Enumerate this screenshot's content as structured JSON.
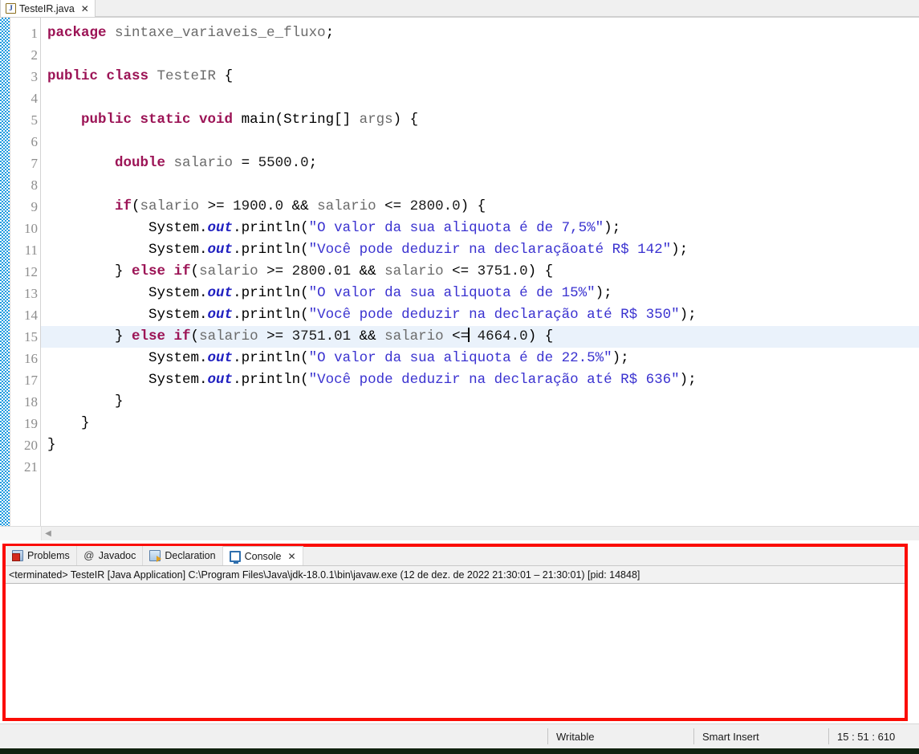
{
  "editor": {
    "tab": {
      "title": "TesteIR.java",
      "icon": "java-file-icon",
      "letter": "J",
      "close": "✕"
    },
    "gutter_lines": [
      "1",
      "2",
      "3",
      "4",
      "5",
      "6",
      "7",
      "8",
      "9",
      "10",
      "11",
      "12",
      "13",
      "14",
      "15",
      "16",
      "17",
      "18",
      "19",
      "20",
      "21"
    ],
    "fold_line": "5",
    "current_line": 15,
    "caret_line_index": 14,
    "code_lines": [
      [
        {
          "t": "package",
          "c": "kw"
        },
        {
          "t": " ",
          "c": "pl"
        },
        {
          "t": "sintaxe_variaveis_e_fluxo",
          "c": "id"
        },
        {
          "t": ";",
          "c": "pl"
        }
      ],
      [],
      [
        {
          "t": "public class",
          "c": "kw"
        },
        {
          "t": " ",
          "c": "pl"
        },
        {
          "t": "TesteIR",
          "c": "id"
        },
        {
          "t": " {",
          "c": "pl"
        }
      ],
      [],
      [
        {
          "t": "    ",
          "c": "pl"
        },
        {
          "t": "public static void",
          "c": "kw"
        },
        {
          "t": " ",
          "c": "pl"
        },
        {
          "t": "main",
          "c": "pl"
        },
        {
          "t": "(",
          "c": "pl"
        },
        {
          "t": "String",
          "c": "pl"
        },
        {
          "t": "[] ",
          "c": "pl"
        },
        {
          "t": "args",
          "c": "id"
        },
        {
          "t": ") {",
          "c": "pl"
        }
      ],
      [],
      [
        {
          "t": "        ",
          "c": "pl"
        },
        {
          "t": "double",
          "c": "kw"
        },
        {
          "t": " ",
          "c": "pl"
        },
        {
          "t": "salario",
          "c": "id"
        },
        {
          "t": " = ",
          "c": "pl"
        },
        {
          "t": "5500.0",
          "c": "num"
        },
        {
          "t": ";",
          "c": "pl"
        }
      ],
      [],
      [
        {
          "t": "        ",
          "c": "pl"
        },
        {
          "t": "if",
          "c": "kw"
        },
        {
          "t": "(",
          "c": "pl"
        },
        {
          "t": "salario",
          "c": "id"
        },
        {
          "t": " >= ",
          "c": "pl"
        },
        {
          "t": "1900.0",
          "c": "num"
        },
        {
          "t": " && ",
          "c": "pl"
        },
        {
          "t": "salario",
          "c": "id"
        },
        {
          "t": " <= ",
          "c": "pl"
        },
        {
          "t": "2800.0",
          "c": "num"
        },
        {
          "t": ") {",
          "c": "pl"
        }
      ],
      [
        {
          "t": "            System.",
          "c": "pl"
        },
        {
          "t": "out",
          "c": "fld"
        },
        {
          "t": ".println(",
          "c": "pl"
        },
        {
          "t": "\"O valor da sua aliquota é de 7,5%\"",
          "c": "str"
        },
        {
          "t": ");",
          "c": "pl"
        }
      ],
      [
        {
          "t": "            System.",
          "c": "pl"
        },
        {
          "t": "out",
          "c": "fld"
        },
        {
          "t": ".println(",
          "c": "pl"
        },
        {
          "t": "\"Você pode deduzir na declaraçãoaté R$ 142\"",
          "c": "str"
        },
        {
          "t": ");",
          "c": "pl"
        }
      ],
      [
        {
          "t": "        } ",
          "c": "pl"
        },
        {
          "t": "else if",
          "c": "kw"
        },
        {
          "t": "(",
          "c": "pl"
        },
        {
          "t": "salario",
          "c": "id"
        },
        {
          "t": " >= ",
          "c": "pl"
        },
        {
          "t": "2800.01",
          "c": "num"
        },
        {
          "t": " && ",
          "c": "pl"
        },
        {
          "t": "salario",
          "c": "id"
        },
        {
          "t": " <= ",
          "c": "pl"
        },
        {
          "t": "3751.0",
          "c": "num"
        },
        {
          "t": ") {",
          "c": "pl"
        }
      ],
      [
        {
          "t": "            System.",
          "c": "pl"
        },
        {
          "t": "out",
          "c": "fld"
        },
        {
          "t": ".println(",
          "c": "pl"
        },
        {
          "t": "\"O valor da sua aliquota é de 15%\"",
          "c": "str"
        },
        {
          "t": ");",
          "c": "pl"
        }
      ],
      [
        {
          "t": "            System.",
          "c": "pl"
        },
        {
          "t": "out",
          "c": "fld"
        },
        {
          "t": ".println(",
          "c": "pl"
        },
        {
          "t": "\"Você pode deduzir na declaração até R$ 350\"",
          "c": "str"
        },
        {
          "t": ");",
          "c": "pl"
        }
      ],
      [
        {
          "t": "        } ",
          "c": "pl"
        },
        {
          "t": "else if",
          "c": "kw"
        },
        {
          "t": "(",
          "c": "pl"
        },
        {
          "t": "salario",
          "c": "id"
        },
        {
          "t": " >= ",
          "c": "pl"
        },
        {
          "t": "3751.01",
          "c": "num"
        },
        {
          "t": " && ",
          "c": "pl"
        },
        {
          "t": "salario",
          "c": "id"
        },
        {
          "t": " <=",
          "c": "pl"
        },
        {
          "t": "CARET",
          "c": "caret"
        },
        {
          "t": " ",
          "c": "pl"
        },
        {
          "t": "4664.0",
          "c": "num"
        },
        {
          "t": ") {",
          "c": "pl"
        }
      ],
      [
        {
          "t": "            System.",
          "c": "pl"
        },
        {
          "t": "out",
          "c": "fld"
        },
        {
          "t": ".println(",
          "c": "pl"
        },
        {
          "t": "\"O valor da sua aliquota é de 22.5%\"",
          "c": "str"
        },
        {
          "t": ");",
          "c": "pl"
        }
      ],
      [
        {
          "t": "            System.",
          "c": "pl"
        },
        {
          "t": "out",
          "c": "fld"
        },
        {
          "t": ".println(",
          "c": "pl"
        },
        {
          "t": "\"Você pode deduzir na declaração até R$ 636\"",
          "c": "str"
        },
        {
          "t": ");",
          "c": "pl"
        }
      ],
      [
        {
          "t": "        }",
          "c": "pl"
        }
      ],
      [
        {
          "t": "    }",
          "c": "pl"
        }
      ],
      [
        {
          "t": "}",
          "c": "pl"
        }
      ],
      []
    ],
    "hscroll": {
      "left_arrow": "◀"
    }
  },
  "console_panel": {
    "highlight_color": "#fb0c05",
    "tabs": [
      {
        "label": "Problems",
        "icon": "problems-icon",
        "active": false,
        "closable": false
      },
      {
        "label": "Javadoc",
        "icon": "javadoc-icon",
        "active": false,
        "closable": false
      },
      {
        "label": "Declaration",
        "icon": "declaration-icon",
        "active": false,
        "closable": false
      },
      {
        "label": "Console",
        "icon": "console-icon",
        "active": true,
        "closable": true
      }
    ],
    "close_glyph": "✕",
    "javadoc_glyph": "@",
    "info_line": "<terminated> TesteIR [Java Application] C:\\Program Files\\Java\\jdk-18.0.1\\bin\\javaw.exe  (12 de dez. de 2022 21:30:01 – 21:30:01) [pid: 14848]",
    "output": ""
  },
  "statusbar": {
    "writable": "Writable",
    "insert_mode": "Smart Insert",
    "position": "15 : 51 : 610"
  }
}
